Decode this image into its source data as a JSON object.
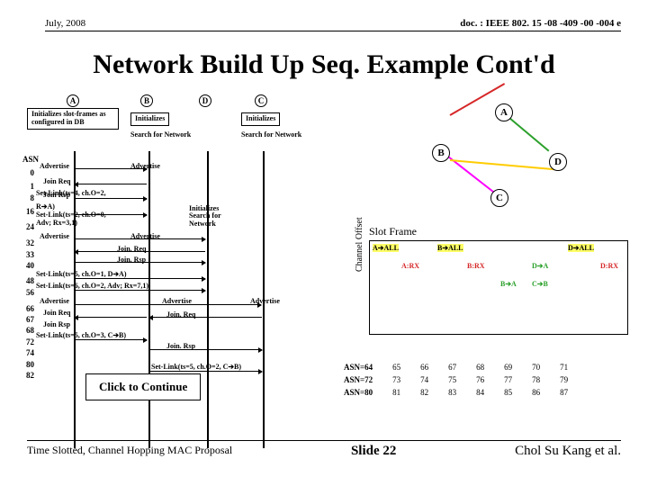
{
  "header": {
    "date": "July, 2008",
    "doc": "doc. : IEEE 802. 15 -08 -409 -00 -004 e"
  },
  "title": "Network Build Up Seq. Example Cont'd",
  "nodes": {
    "A": "A",
    "B": "B",
    "C": "C",
    "D": "D"
  },
  "init_db": "Initializes slot-frames as configured in DB",
  "init": "Initializes",
  "search_net": "Search for Network",
  "asn_label": "ASN",
  "asn_values": [
    "0",
    "1",
    "8",
    "16",
    "24",
    "32",
    "33",
    "40",
    "48",
    "56",
    "66",
    "67",
    "68",
    "72",
    "74",
    "80",
    "82"
  ],
  "events": {
    "advertise": "Advertise",
    "join_req": "Join Req",
    "join_rsp": "Join Rsp",
    "join_req_dot": "Join. Req",
    "join_rsp_dot": "Join. Rsp",
    "setlink_8": "Set-Link(ts=4, ch.O=2,",
    "setlink_16": "R➔A)\nSet-Link(ts=2, ch.O=0,",
    "setlink_24": "Adv; Rx=3,1)",
    "inits_search": "Initializes\nSearch for\nNetwork",
    "setlink_48": "Set-Link(ts=5, ch.O=1, D➔A)",
    "setlink_56": "Set-Link(ts=6, ch.O=2, Adv; Rx=7,1)",
    "setlink_72": "Set-Link(ts=5, ch.O=3, C➔B)",
    "setlink_82": "Set-Link(ts=5, ch.O=2, C➔B)"
  },
  "slot_frame_title": "Slot Frame",
  "ch_offset_label": "Channel Offset",
  "slots": {
    "a_all": "A➔ALL",
    "b_all": "B➔ALL",
    "d_all": "D➔ALL",
    "a_rx": "A:RX",
    "b_rx": "B:RX",
    "d_a": "D➔A",
    "d_rx": "D:RX",
    "b_a": "B➔A",
    "c_b": "C➔B"
  },
  "asn_table": {
    "rows": [
      {
        "label": "ASN=64",
        "vals": [
          "65",
          "66",
          "67",
          "68",
          "69",
          "70",
          "71"
        ]
      },
      {
        "label": "ASN=72",
        "vals": [
          "73",
          "74",
          "75",
          "76",
          "77",
          "78",
          "79"
        ]
      },
      {
        "label": "ASN=80",
        "vals": [
          "81",
          "82",
          "83",
          "84",
          "85",
          "86",
          "87"
        ]
      }
    ]
  },
  "click_btn": "Click to Continue",
  "footer": {
    "left": "Time Slotted, Channel Hopping MAC Proposal",
    "center": "Slide 22",
    "right": "Chol Su Kang et al."
  }
}
